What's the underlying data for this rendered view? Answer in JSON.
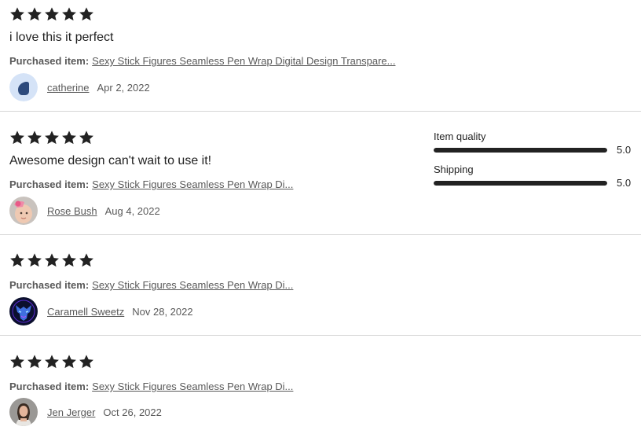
{
  "reviews": [
    {
      "rating": 5,
      "text": "i love this it perfect",
      "purchased_label": "Purchased item:",
      "item_title": "Sexy Stick Figures Seamless Pen Wrap Digital Design Transpare...",
      "reviewer_name": "catherine",
      "date": "Apr 2, 2022",
      "avatar": "default-blue-avatar"
    },
    {
      "rating": 5,
      "text": "Awesome design can't wait to use it!",
      "purchased_label": "Purchased item:",
      "item_title": "Sexy Stick Figures Seamless Pen Wrap Di...",
      "reviewer_name": "Rose Bush",
      "date": "Aug 4, 2022",
      "avatar": "baby-photo-avatar"
    },
    {
      "rating": 5,
      "text": "",
      "purchased_label": "Purchased item:",
      "item_title": "Sexy Stick Figures Seamless Pen Wrap Di...",
      "reviewer_name": "Caramell Sweetz",
      "date": "Nov 28, 2022",
      "avatar": "neon-wolf-avatar"
    },
    {
      "rating": 5,
      "text": "",
      "purchased_label": "Purchased item:",
      "item_title": "Sexy Stick Figures Seamless Pen Wrap Di...",
      "reviewer_name": "Jen Jerger",
      "date": "Oct 26, 2022",
      "avatar": "person-photo-avatar"
    }
  ],
  "ratings_breakdown": [
    {
      "label": "Item quality",
      "value": "5.0",
      "fraction": 1.0
    },
    {
      "label": "Shipping",
      "value": "5.0",
      "fraction": 1.0
    }
  ],
  "colors": {
    "star": "#222222",
    "text": "#222222",
    "muted": "#595959",
    "divider": "#d6d6d6",
    "bar_fill": "#222222"
  }
}
